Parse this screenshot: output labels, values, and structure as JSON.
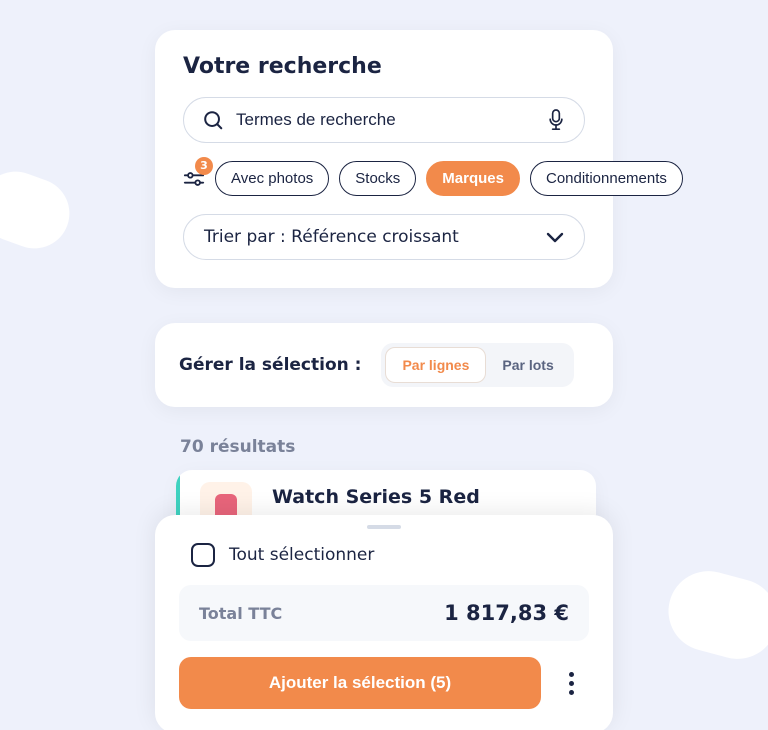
{
  "search": {
    "title": "Votre recherche",
    "placeholder": "Termes de recherche",
    "filter_badge": "3",
    "filters": [
      {
        "label": "Avec photos",
        "active": false
      },
      {
        "label": "Stocks",
        "active": false
      },
      {
        "label": "Marques",
        "active": true
      },
      {
        "label": "Conditionnements",
        "active": false
      }
    ],
    "sort_label": "Trier par : Référence croissant"
  },
  "manage": {
    "label": "Gérer la sélection :",
    "options": [
      {
        "label": "Par lignes",
        "active": true
      },
      {
        "label": "Par lots",
        "active": false
      }
    ]
  },
  "results": {
    "count_label": "70 résultats",
    "product_title": "Watch Series 5 Red"
  },
  "selection": {
    "select_all_label": "Tout sélectionner",
    "total_label": "Total TTC",
    "total_value": "1 817,83 €",
    "add_button": "Ajouter la sélection (5)"
  }
}
